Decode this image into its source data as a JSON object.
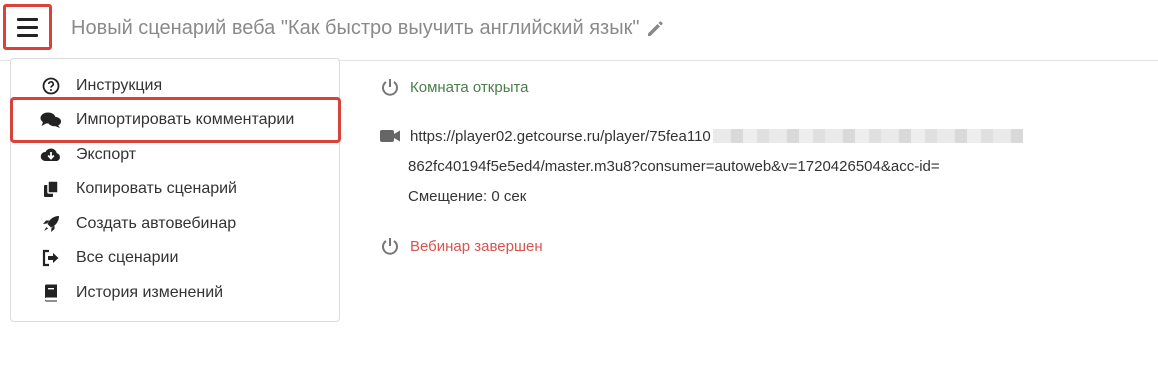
{
  "header": {
    "title": "Новый сценарий веба \"Как быстро выучить английский язык\"",
    "menu_icon": "hamburger-icon",
    "edit_icon": "pencil-icon"
  },
  "menu": {
    "items": [
      {
        "label": "Инструкция",
        "icon": "question-circle-icon"
      },
      {
        "label": "Импортировать комментарии",
        "icon": "comments-icon"
      },
      {
        "label": "Экспорт",
        "icon": "cloud-download-icon"
      },
      {
        "label": "Копировать сценарий",
        "icon": "copy-icon"
      },
      {
        "label": "Создать автовебинар",
        "icon": "rocket-icon"
      },
      {
        "label": "Все сценарии",
        "icon": "sign-out-icon"
      },
      {
        "label": "История изменений",
        "icon": "book-icon"
      }
    ]
  },
  "main": {
    "room_status": "Комната открыта",
    "video_url_line1": "https://player02.getcourse.ru/player/75fea110",
    "video_url_line2": "862fc40194f5e5ed4/master.m3u8?consumer=autoweb&v=1720426504&acc-id=",
    "offset": "Смещение: 0 сек",
    "webinar_status": "Вебинар завершен"
  },
  "colors": {
    "highlight": "#d9423a",
    "room_status": "#4a7f4a",
    "webinar_status": "#d9534f"
  }
}
